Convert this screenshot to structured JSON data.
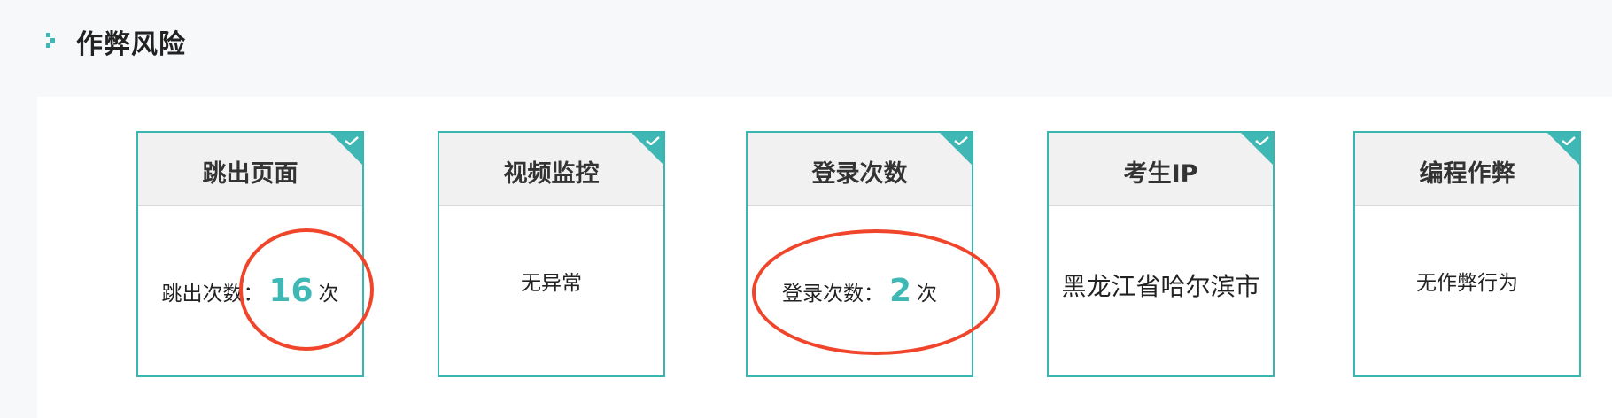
{
  "section": {
    "title": "作弊风险"
  },
  "colors": {
    "accent": "#3fb8b5",
    "highlight": "#f0452b"
  },
  "cards": [
    {
      "title": "跳出页面",
      "label": "跳出次数：",
      "value": "16",
      "unit": "次",
      "checked": true
    },
    {
      "title": "视频监控",
      "text": "无异常",
      "checked": true
    },
    {
      "title": "登录次数",
      "label": "登录次数：",
      "value": "2",
      "unit": "次",
      "checked": true
    },
    {
      "title": "考生IP",
      "text": "黑龙江省哈尔滨市",
      "checked": true
    },
    {
      "title": "编程作弊",
      "text": "无作弊行为",
      "checked": true
    }
  ]
}
